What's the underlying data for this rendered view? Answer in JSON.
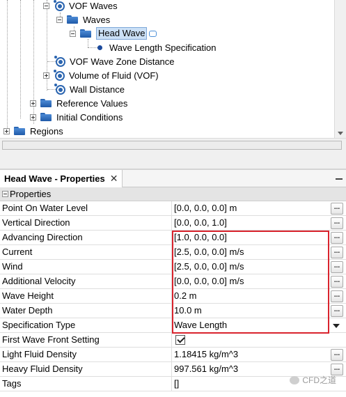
{
  "tree": {
    "items": [
      {
        "label": "VOF Waves"
      },
      {
        "label": "Waves"
      },
      {
        "label": "Head Wave"
      },
      {
        "label": "Wave Length Specification"
      },
      {
        "label": "VOF Wave Zone Distance"
      },
      {
        "label": "Volume of Fluid (VOF)"
      },
      {
        "label": "Wall Distance"
      },
      {
        "label": "Reference Values"
      },
      {
        "label": "Initial Conditions"
      },
      {
        "label": "Regions"
      }
    ]
  },
  "properties_panel": {
    "tab_title": "Head Wave - Properties",
    "section_title": "Properties",
    "rows": [
      {
        "name": "Point On Water Level",
        "value": "[0.0, 0.0, 0.0] m"
      },
      {
        "name": "Vertical Direction",
        "value": "[0.0, 0.0, 1.0]"
      },
      {
        "name": "Advancing Direction",
        "value": "[1.0, 0.0, 0.0]"
      },
      {
        "name": "Current",
        "value": "[2.5, 0.0, 0.0] m/s"
      },
      {
        "name": "Wind",
        "value": "[2.5, 0.0, 0.0] m/s"
      },
      {
        "name": "Additional Velocity",
        "value": "[0.0, 0.0, 0.0] m/s"
      },
      {
        "name": "Wave Height",
        "value": "0.2 m"
      },
      {
        "name": "Water Depth",
        "value": "10.0 m"
      },
      {
        "name": "Specification Type",
        "value": "Wave Length"
      },
      {
        "name": "First Wave Front Setting",
        "value": "",
        "checked": true
      },
      {
        "name": "Light Fluid Density",
        "value": "1.18415 kg/m^3"
      },
      {
        "name": "Heavy Fluid Density",
        "value": "997.561 kg/m^3"
      },
      {
        "name": "Tags",
        "value": "[]"
      }
    ],
    "ellipsis_label": "..."
  },
  "watermark": "CFD之道",
  "colors": {
    "folder": "#2a67b5",
    "selection": "#cbe0f6",
    "highlight_box": "#d9232d"
  }
}
